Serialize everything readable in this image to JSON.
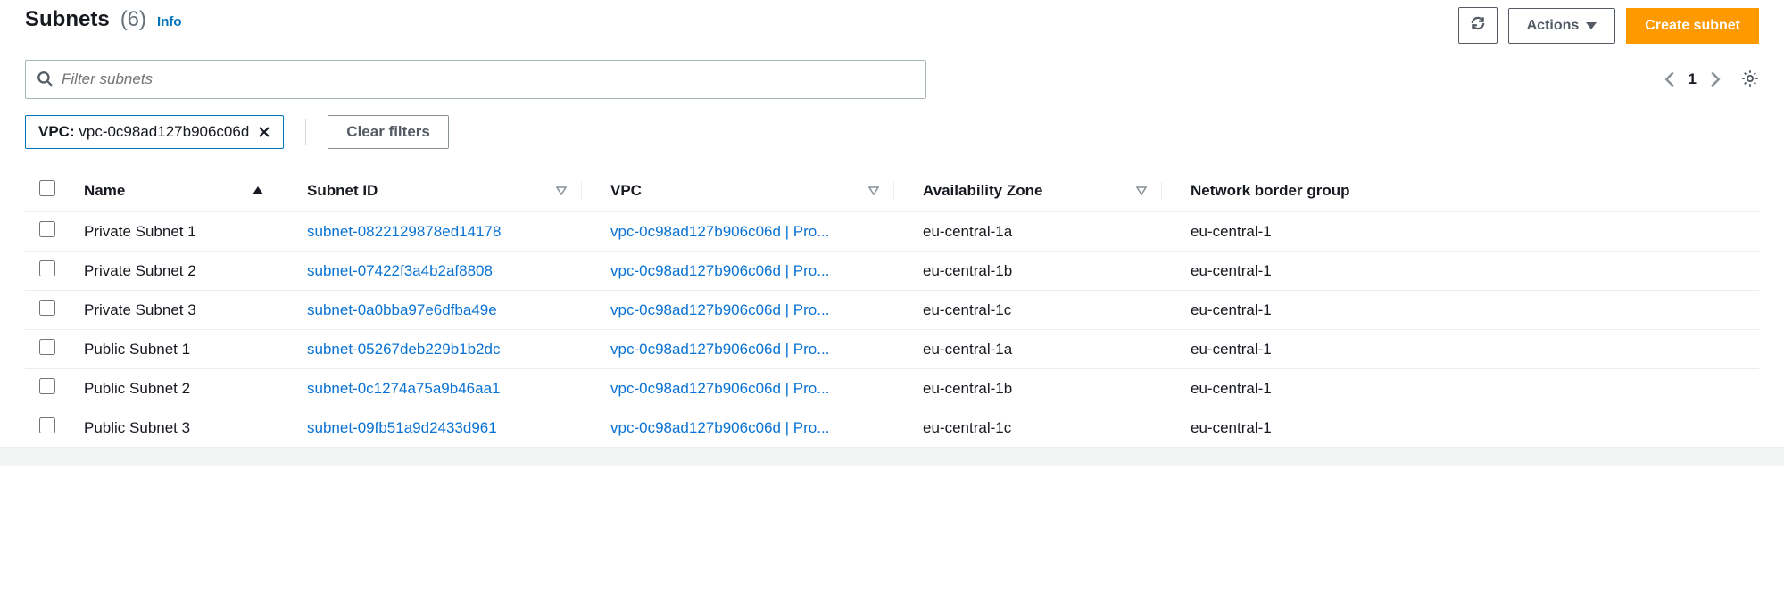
{
  "header": {
    "title": "Subnets",
    "count": "(6)",
    "info_label": "Info",
    "actions_label": "Actions",
    "create_label": "Create subnet"
  },
  "search": {
    "placeholder": "Filter subnets"
  },
  "pagination": {
    "page": "1"
  },
  "filters": {
    "chip_key": "VPC:",
    "chip_value": "vpc-0c98ad127b906c06d",
    "clear_label": "Clear filters"
  },
  "columns": {
    "name": "Name",
    "subnet_id": "Subnet ID",
    "vpc": "VPC",
    "az": "Availability Zone",
    "nbg": "Network border group"
  },
  "rows": [
    {
      "name": "Private Subnet 1",
      "subnet_id": "subnet-0822129878ed14178",
      "vpc": "vpc-0c98ad127b906c06d | Pro...",
      "az": "eu-central-1a",
      "nbg": "eu-central-1"
    },
    {
      "name": "Private Subnet 2",
      "subnet_id": "subnet-07422f3a4b2af8808",
      "vpc": "vpc-0c98ad127b906c06d | Pro...",
      "az": "eu-central-1b",
      "nbg": "eu-central-1"
    },
    {
      "name": "Private Subnet 3",
      "subnet_id": "subnet-0a0bba97e6dfba49e",
      "vpc": "vpc-0c98ad127b906c06d | Pro...",
      "az": "eu-central-1c",
      "nbg": "eu-central-1"
    },
    {
      "name": "Public Subnet 1",
      "subnet_id": "subnet-05267deb229b1b2dc",
      "vpc": "vpc-0c98ad127b906c06d | Pro...",
      "az": "eu-central-1a",
      "nbg": "eu-central-1"
    },
    {
      "name": "Public Subnet 2",
      "subnet_id": "subnet-0c1274a75a9b46aa1",
      "vpc": "vpc-0c98ad127b906c06d | Pro...",
      "az": "eu-central-1b",
      "nbg": "eu-central-1"
    },
    {
      "name": "Public Subnet 3",
      "subnet_id": "subnet-09fb51a9d2433d961",
      "vpc": "vpc-0c98ad127b906c06d | Pro...",
      "az": "eu-central-1c",
      "nbg": "eu-central-1"
    }
  ]
}
